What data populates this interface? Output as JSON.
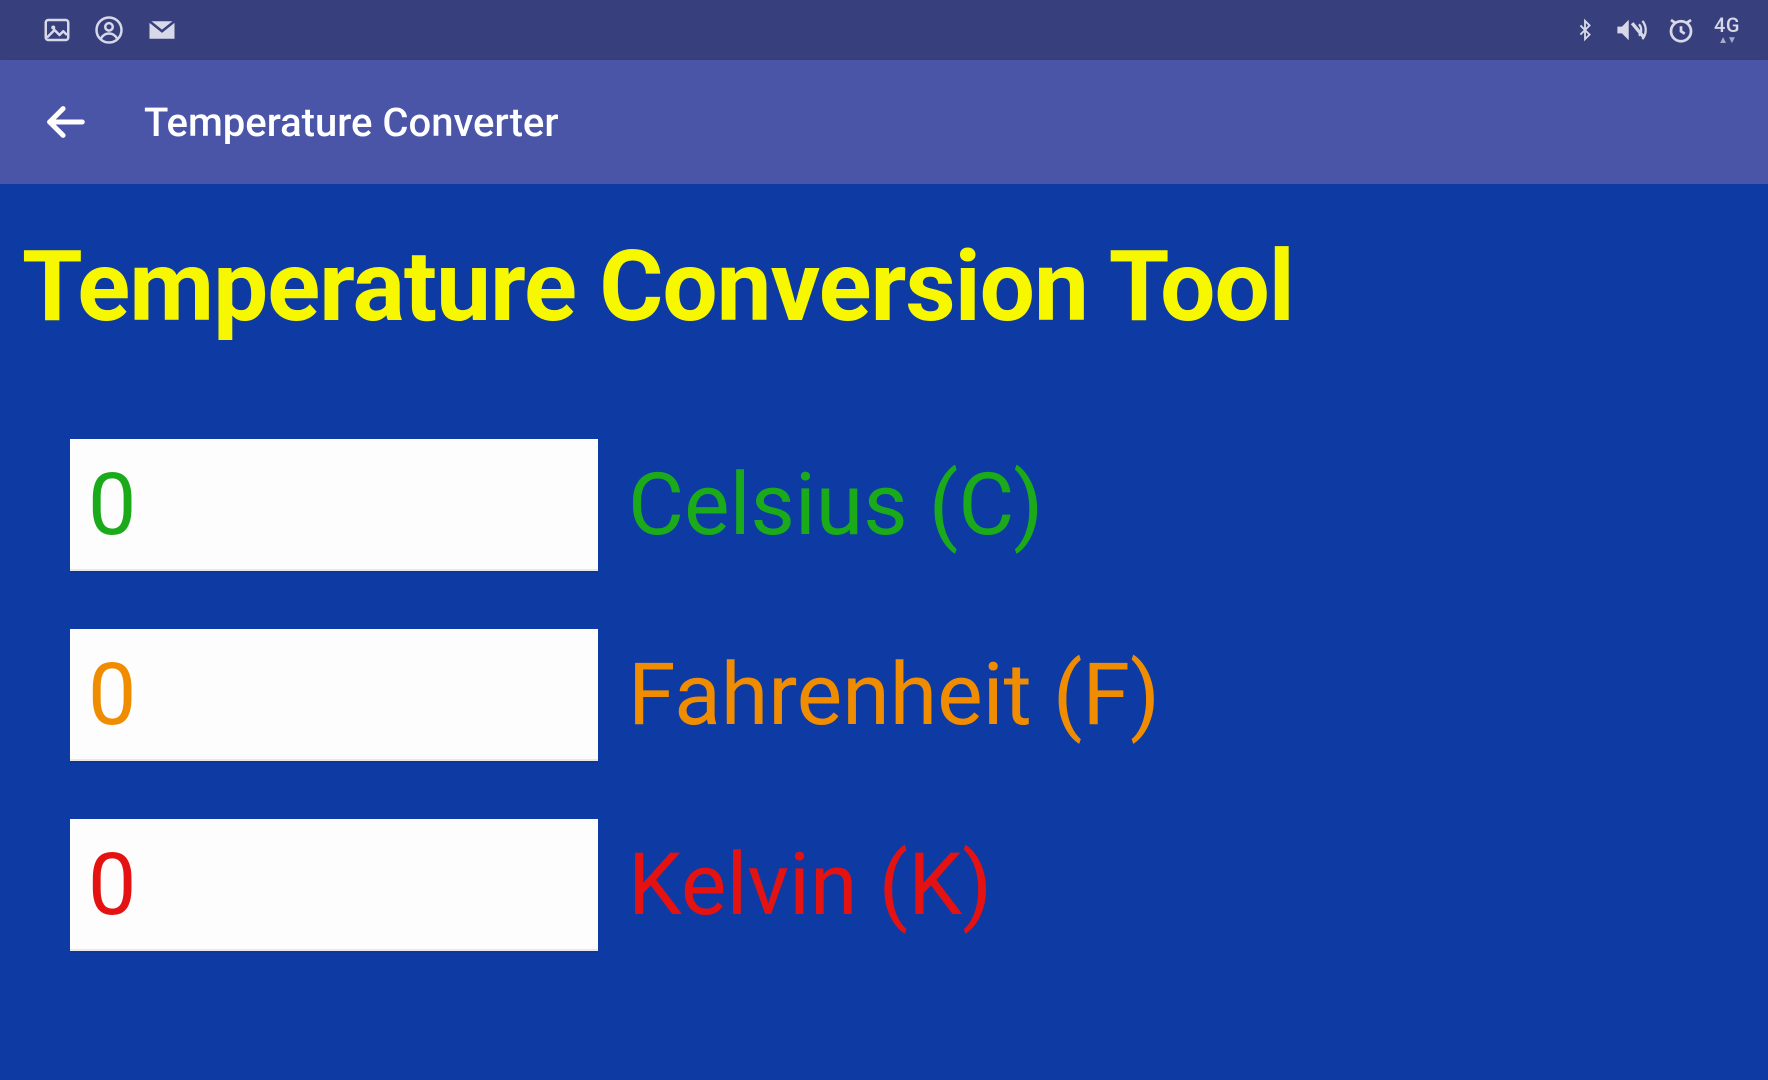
{
  "status_bar": {
    "network_label": "4G"
  },
  "app_bar": {
    "title": "Temperature Converter"
  },
  "main": {
    "heading": "Temperature Conversion Tool",
    "rows": [
      {
        "value": "0",
        "label": "Celsius (C)"
      },
      {
        "value": "0",
        "label": "Fahrenheit (F)"
      },
      {
        "value": "0",
        "label": "Kelvin (K)"
      }
    ]
  }
}
